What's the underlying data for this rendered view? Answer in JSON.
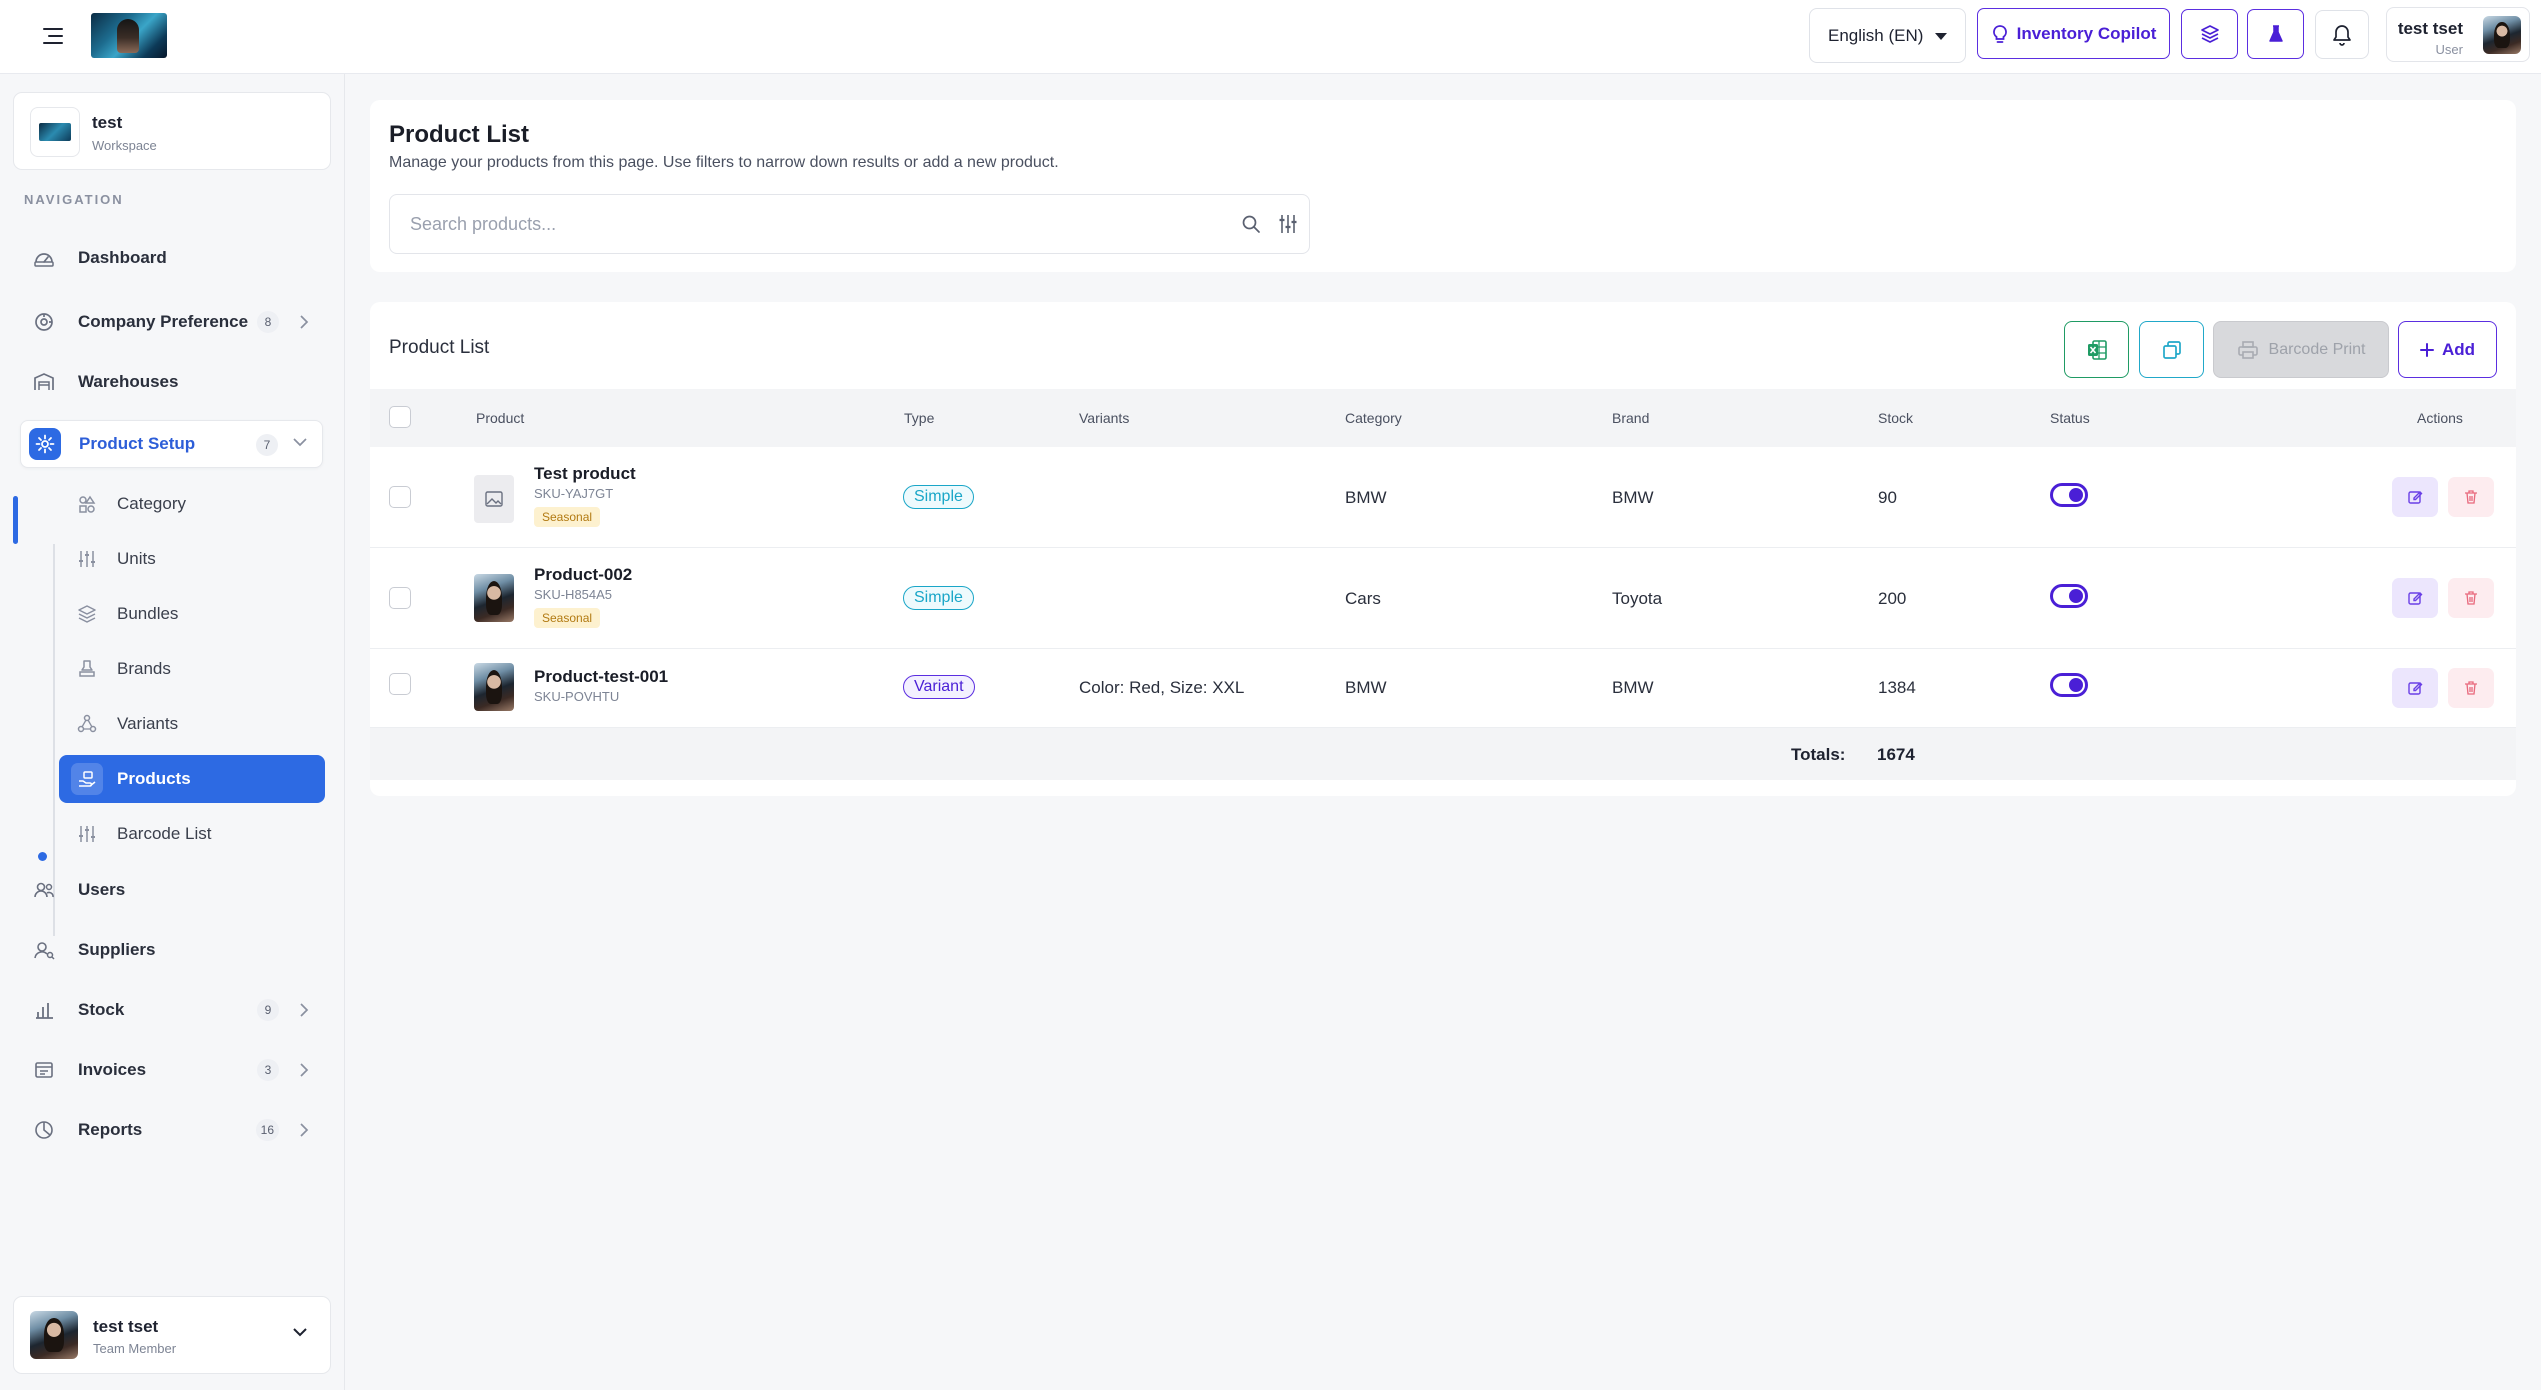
{
  "topbar": {
    "language": "English (EN)",
    "copilot_label": "Inventory Copilot",
    "user_name": "test tset",
    "user_role": "User"
  },
  "workspace": {
    "name": "test",
    "label": "Workspace"
  },
  "sidebar": {
    "heading": "NAVIGATION",
    "items": [
      {
        "label": "Dashboard",
        "icon": "dashboard-icon"
      },
      {
        "label": "Company Preference",
        "icon": "company-icon",
        "badge": "8"
      },
      {
        "label": "Warehouses",
        "icon": "warehouse-icon"
      },
      {
        "label": "Product Setup",
        "icon": "gear-icon",
        "badge": "7",
        "open": true
      },
      {
        "label": "Users",
        "icon": "users-icon"
      },
      {
        "label": "Suppliers",
        "icon": "supplier-icon"
      },
      {
        "label": "Stock",
        "icon": "stock-chart-icon",
        "badge": "9"
      },
      {
        "label": "Invoices",
        "icon": "invoice-icon",
        "badge": "3"
      },
      {
        "label": "Reports",
        "icon": "pie-chart-icon",
        "badge": "16"
      }
    ],
    "subitems": [
      {
        "label": "Category",
        "icon": "category-icon"
      },
      {
        "label": "Units",
        "icon": "sliders-icon"
      },
      {
        "label": "Bundles",
        "icon": "layers-icon"
      },
      {
        "label": "Brands",
        "icon": "stamp-icon"
      },
      {
        "label": "Variants",
        "icon": "variants-icon"
      },
      {
        "label": "Products",
        "icon": "hand-box-icon",
        "active": true
      },
      {
        "label": "Barcode List",
        "icon": "barcode-icon"
      }
    ]
  },
  "bottom_user": {
    "name": "test tset",
    "role": "Team Member"
  },
  "header": {
    "title": "Product List",
    "description": "Manage your products from this page. Use filters to narrow down results or add a new product.",
    "search_placeholder": "Search products..."
  },
  "table": {
    "title": "Product List",
    "barcode_label": "Barcode Print",
    "add_label": "Add",
    "columns": [
      "Product",
      "Type",
      "Variants",
      "Category",
      "Brand",
      "Stock",
      "Status",
      "Actions"
    ],
    "rows": [
      {
        "name": "Test product",
        "sku": "SKU-YAJ7GT",
        "tag": "Seasonal",
        "type": "Simple",
        "variants": "",
        "category": "BMW",
        "brand": "BMW",
        "stock": "90",
        "status": true
      },
      {
        "name": "Product-002",
        "sku": "SKU-H854A5",
        "tag": "Seasonal",
        "type": "Simple",
        "variants": "",
        "category": "Cars",
        "brand": "Toyota",
        "stock": "200",
        "status": true
      },
      {
        "name": "Product-test-001",
        "sku": "SKU-POVHTU",
        "tag": "",
        "type": "Variant",
        "variants": "Color: Red, Size: XXL",
        "category": "BMW",
        "brand": "BMW",
        "stock": "1384",
        "status": true
      }
    ],
    "totals_label": "Totals:",
    "totals_value": "1674"
  },
  "colors": {
    "accent_blue": "#2d6ae3",
    "accent_purple": "#4a1fd6",
    "excel_green": "#1f9b64",
    "cyan": "#1aa6c8",
    "seasonal_bg": "#fdf1cf",
    "delete_red": "#e8687c"
  }
}
